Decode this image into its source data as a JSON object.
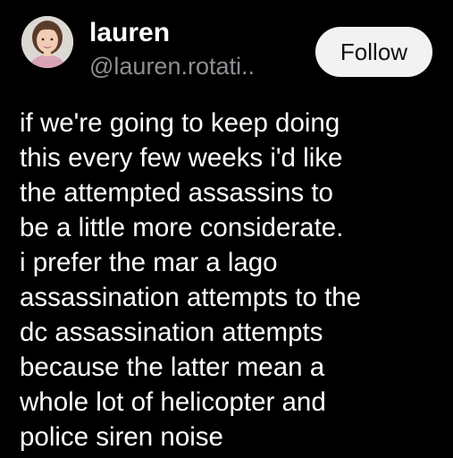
{
  "author": {
    "display_name": "lauren",
    "handle": "@lauren.rotati..",
    "avatar_icon": "profile-photo"
  },
  "follow_button": {
    "label": "Follow"
  },
  "post": {
    "lines": [
      "if we're going to keep doing",
      "this every few weeks i'd like",
      "the attempted assassins to",
      "be a little more considerate.",
      "i prefer the mar a lago",
      "assassination attempts to the",
      "dc assassination attempts",
      "because the latter mean a",
      "whole lot of helicopter and",
      "police siren noise"
    ]
  },
  "colors": {
    "background": "#000000",
    "text": "#ffffff",
    "handle": "#8e8e93",
    "button_bg": "#f2f2f2",
    "button_text": "#111111"
  }
}
